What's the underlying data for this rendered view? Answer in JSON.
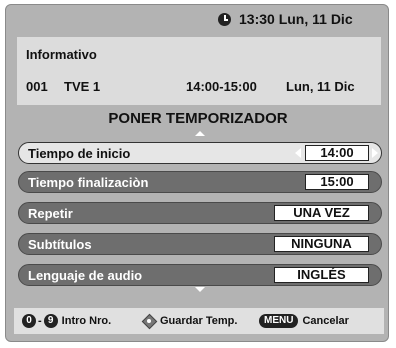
{
  "clock": {
    "text": "13:30 Lun, 11 Dic"
  },
  "info": {
    "title": "Informativo",
    "channel_number": "001",
    "channel_name": "TVE 1",
    "time_range": "14:00-15:00",
    "date": "Lun, 11 Dic"
  },
  "heading": "PONER TEMPORIZADOR",
  "rows": [
    {
      "label": "Tiempo de inicio",
      "value": "14:00",
      "selected": true
    },
    {
      "label": "Tiempo finalizaciòn",
      "value": "15:00",
      "selected": false
    },
    {
      "label": "Repetir",
      "value": "UNA VEZ",
      "selected": false
    },
    {
      "label": "Subtítulos",
      "value": "NINGUNA",
      "selected": false
    },
    {
      "label": "Lenguaje de audio",
      "value": "INGLÉS",
      "selected": false
    }
  ],
  "footer": {
    "key_start": "0",
    "key_dash": "-",
    "key_end": "9",
    "intro_label": "Intro Nro.",
    "save_label": "Guardar Temp.",
    "menu_key": "MENU",
    "cancel_label": "Cancelar"
  }
}
